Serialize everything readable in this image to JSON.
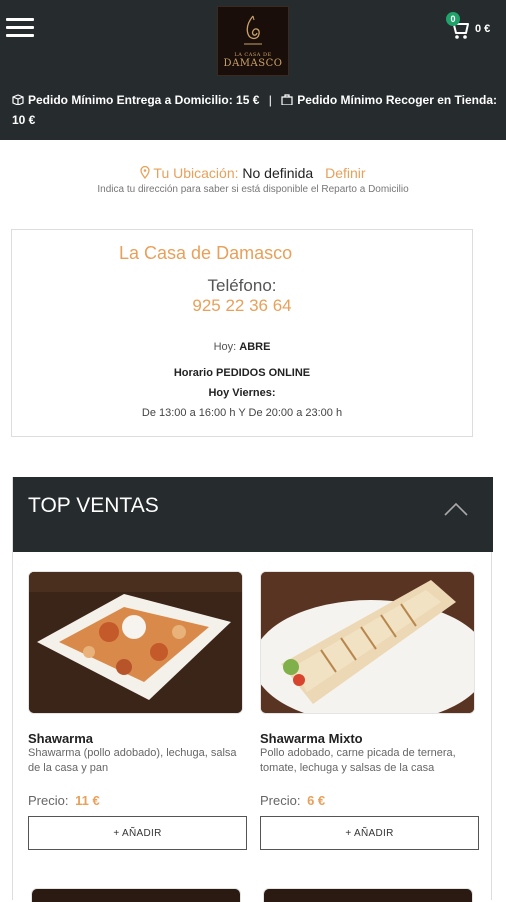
{
  "header": {
    "logo_small_text": "LA CASA DE",
    "logo_big_text": "DAMASCO",
    "cart_count": "0",
    "cart_total": "0 €"
  },
  "min_order": {
    "delivery_text": "Pedido Mínimo Entrega a Domicilio: 15 €",
    "separator": "|",
    "pickup_text": "Pedido Mínimo Recoger en Tienda: 10 €"
  },
  "location": {
    "label": "Tu Ubicación:",
    "value": "No definida",
    "define_link": "Definir",
    "hint": "Indica tu dirección para saber si está disponible el Reparto a Domicilio"
  },
  "restaurant": {
    "name": "La Casa de Damasco",
    "phone_label": "Teléfono:",
    "phone": "925 22 36 64",
    "today_label": "Hoy:",
    "today_status": "ABRE",
    "online_hours_title": "Horario PEDIDOS ONLINE",
    "today_day": "Hoy Viernes:",
    "hours": "De 13:00 a 16:00 h Y De 20:00 a 23:00 h"
  },
  "section": {
    "title": "TOP VENTAS"
  },
  "products": [
    {
      "name": "Shawarma",
      "description": "Shawarma (pollo adobado), lechuga, salsa de la casa y pan",
      "price_label": "Precio:",
      "price": "11 €",
      "add_label": "+ AÑADIR"
    },
    {
      "name": "Shawarma Mixto",
      "description": "Pollo adobado, carne picada de ternera, tomate, lechuga y salsas de la casa",
      "price_label": "Precio:",
      "price": "6 €",
      "add_label": "+ AÑADIR"
    }
  ],
  "colors": {
    "accent": "#e8a05a",
    "header_bg": "#262b2e",
    "badge": "#1fa36b"
  }
}
